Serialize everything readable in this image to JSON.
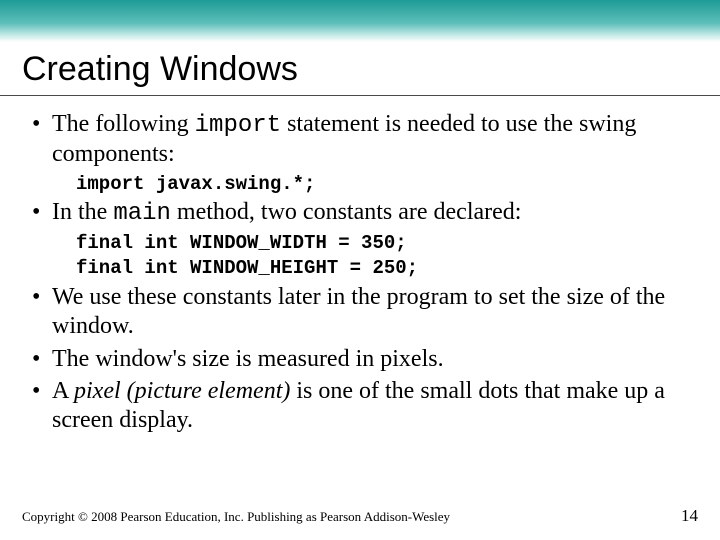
{
  "title": "Creating Windows",
  "bullets": {
    "b1_pre": "The following ",
    "b1_code": "import",
    "b1_post": " statement is needed to use the swing components:",
    "code1": "import javax.swing.*;",
    "b2_pre": "In the ",
    "b2_code": "main",
    "b2_post": " method, two constants are declared:",
    "code2a": "final int WINDOW_WIDTH = 350;",
    "code2b": "final int WINDOW_HEIGHT = 250;",
    "b3": "We use these constants later in the program to set the size of the window.",
    "b4": "The window's size is measured in pixels.",
    "b5_pre": "A ",
    "b5_ital": "pixel (picture element)",
    "b5_post": " is one of the small dots that make up a screen display."
  },
  "footer": {
    "copyright": "Copyright © 2008 Pearson Education, Inc. Publishing as Pearson Addison-Wesley",
    "page": "14"
  }
}
